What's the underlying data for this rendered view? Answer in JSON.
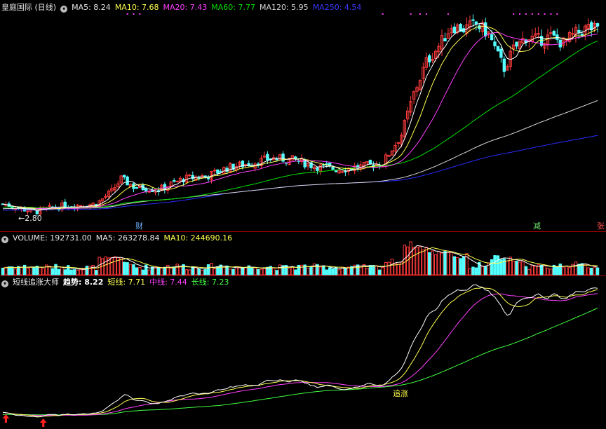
{
  "colors": {
    "up": "#ff3b3b",
    "down": "#54ffff",
    "ma5": "#ffffff",
    "ma10": "#ffff4f",
    "ma20": "#ff40ff",
    "ma60": "#00e000",
    "ma120": "#d8d8d8",
    "ma250": "#2a2aff",
    "divider": "#b00000",
    "trend": "#ffffff",
    "short": "#ffff4f",
    "mid": "#ff40ff",
    "long": "#40ff40"
  },
  "price_header": {
    "title": "皇庭国际 (日线)",
    "ma5": "MA5: 8.24",
    "ma10": "MA10: 7.68",
    "ma20": "MA20: 7.43",
    "ma60": "MA60: 7.77",
    "ma120": "MA120: 5.95",
    "ma250": "MA250: 4.54"
  },
  "price_annotations": {
    "low_label": "←2.80",
    "event_cai": "财",
    "event_jian": "减",
    "event_zhang": "张"
  },
  "volume_header": {
    "title": "VOLUME: 192731.00",
    "ma5": "MA5: 263278.84",
    "ma10": "MA10: 244690.16"
  },
  "indicator_header": {
    "title": "短线追涨大师",
    "trend": "趋势: 8.22",
    "short": "短线: 7.71",
    "mid": "中线: 7.44",
    "long": "长线: 7.23"
  },
  "indicator_annotations": {
    "signal": "追涨"
  },
  "chart_data": [
    {
      "type": "candlestick",
      "title": "皇庭国际 (日线)",
      "ylim": [
        2.5,
        9.3
      ],
      "min_marked": 2.8,
      "anchors": [
        [
          0,
          3.1
        ],
        [
          10,
          2.86
        ],
        [
          20,
          3.05
        ],
        [
          30,
          3.1
        ],
        [
          35,
          3.5
        ],
        [
          38,
          3.9
        ],
        [
          42,
          3.65
        ],
        [
          50,
          3.55
        ],
        [
          58,
          3.9
        ],
        [
          66,
          4.0
        ],
        [
          72,
          4.25
        ],
        [
          80,
          4.4
        ],
        [
          86,
          4.55
        ],
        [
          94,
          4.5
        ],
        [
          100,
          4.3
        ],
        [
          108,
          4.2
        ],
        [
          116,
          4.3
        ],
        [
          122,
          4.4
        ],
        [
          128,
          5.3
        ],
        [
          132,
          6.6
        ],
        [
          136,
          7.6
        ],
        [
          140,
          8.1
        ],
        [
          144,
          8.75
        ],
        [
          148,
          8.65
        ],
        [
          152,
          8.8
        ],
        [
          156,
          8.5
        ],
        [
          159,
          7.8
        ],
        [
          161,
          7.4
        ],
        [
          164,
          8.0
        ],
        [
          168,
          8.4
        ],
        [
          172,
          8.3
        ],
        [
          176,
          8.4
        ],
        [
          180,
          8.2
        ],
        [
          184,
          8.5
        ],
        [
          188,
          8.7
        ],
        [
          191,
          8.6
        ]
      ],
      "series": [
        {
          "name": "MA5",
          "value": 8.24
        },
        {
          "name": "MA10",
          "value": 7.68
        },
        {
          "name": "MA20",
          "value": 7.43
        },
        {
          "name": "MA60",
          "value": 7.77
        },
        {
          "name": "MA120",
          "value": 5.95
        },
        {
          "name": "MA250",
          "value": 4.54
        }
      ]
    },
    {
      "type": "bar",
      "title": "VOLUME",
      "last": 192731.0,
      "ma5": 263278.84,
      "ma10": 244690.16
    },
    {
      "type": "line",
      "title": "短线追涨大师",
      "series": [
        {
          "name": "趋势",
          "value": 8.22
        },
        {
          "name": "短线",
          "value": 7.71
        },
        {
          "name": "中线",
          "value": 7.44
        },
        {
          "name": "长线",
          "value": 7.23
        }
      ]
    }
  ]
}
